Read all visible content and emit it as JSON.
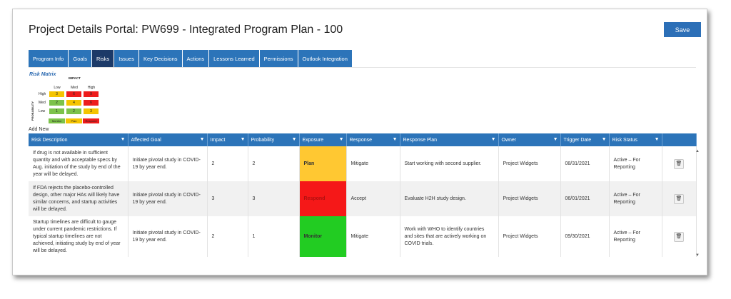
{
  "header": {
    "title": "Project Details Portal: PW699 - Integrated Program Plan - 100",
    "save_label": "Save"
  },
  "tabs": [
    "Program Info",
    "Goals",
    "Risks",
    "Issues",
    "Key Decisions",
    "Actions",
    "Lessons Learned",
    "Permissions",
    "Outlook Integration"
  ],
  "active_tab": "Risks",
  "risk_matrix": {
    "title": "Risk Matrix",
    "impact_label": "IMPACT",
    "probability_label": "PROBABILITY",
    "columns": [
      "Low",
      "Med",
      "High"
    ],
    "rows": [
      {
        "label": "High",
        "cells": [
          "3",
          "6",
          "9"
        ]
      },
      {
        "label": "Med",
        "cells": [
          "2",
          "4",
          "6"
        ]
      },
      {
        "label": "Low",
        "cells": [
          "1",
          "2",
          "3"
        ]
      }
    ],
    "legend": [
      "Monitor",
      "Plan",
      "Respond"
    ],
    "colors": {
      "green": "#7cc24a",
      "yellow": "#f5c400",
      "red": "#ee1c1c"
    }
  },
  "add_new_label": "Add New",
  "table": {
    "headers": [
      "Risk Description",
      "Affected Goal",
      "Impact",
      "Probability",
      "Exposure",
      "Response",
      "Response Plan",
      "Owner",
      "Trigger Date",
      "Risk Status"
    ],
    "filter_icon": "filter-icon",
    "rows": [
      {
        "description": "If drug is not available in sufficient quantity and with acceptable specs by Aug. initiation of the study by end of the year will be delayed.",
        "goal": "Initiate pivotal study in COVID-19 by year end.",
        "impact": "2",
        "probability": "2",
        "exposure": "Plan",
        "exposure_color": "#ffc832",
        "response": "Mitigate",
        "plan": "Start working with second supplier.",
        "owner": "Project Widgets",
        "trigger_date": "08/31/2021",
        "status": "Active – For Reporting"
      },
      {
        "description": "If FDA rejects the placebo-controlled design, other major HAs will likely have similar concerns, and startup activities will be delayed.",
        "goal": "Initiate pivotal study in COVID-19 by year end.",
        "impact": "3",
        "probability": "3",
        "exposure": "Respond",
        "exposure_color": "#f51818",
        "response": "Accept",
        "plan": "Evaluate H2H study design.",
        "owner": "Project Widgets",
        "trigger_date": "06/01/2021",
        "status": "Active – For Reporting"
      },
      {
        "description": "Startup timelines are difficult to gauge under current pandemic restrictions. If typical startup timelines are not achieved, initiating study by end of year will be delayed.",
        "goal": "Initiate pivotal study in COVID-19 by year end.",
        "impact": "2",
        "probability": "1",
        "exposure": "Monitor",
        "exposure_color": "#22cc22",
        "response": "Mitigate",
        "plan": "Work with WHO to identify countries and sites that are actively working on COVID trials.",
        "owner": "Project Widgets",
        "trigger_date": "09/30/2021",
        "status": "Active – For Reporting"
      }
    ]
  }
}
